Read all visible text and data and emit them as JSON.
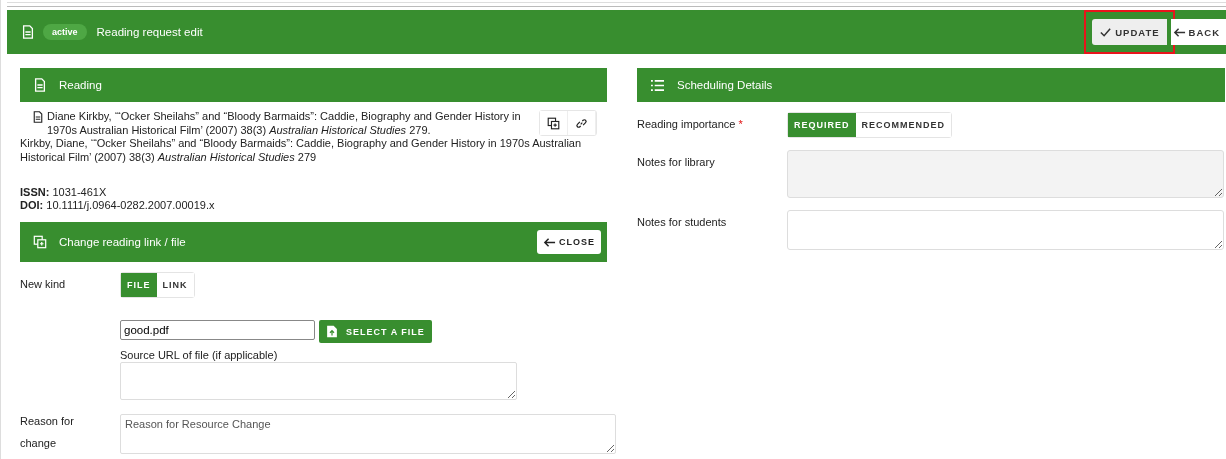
{
  "header": {
    "status": "active",
    "title": "Reading request edit",
    "buttons": [
      {
        "label": "UPDATE",
        "highlighted": true
      },
      {
        "label": "BACK",
        "highlighted": false
      }
    ]
  },
  "reading": {
    "title": "Reading",
    "citations": [
      "Diane Kirkby, ‘“Ocker Sheilahs” and “Bloody Barmaids”: Caddie, Biography and Gender History in 1970s Australian Historical Film’ (2007) 38(3) *Australian Historical Studies* 279.",
      "Kirkby, Diane, ‘“Ocker Sheilahs” and “Bloody Barmaids”: Caddie, Biography and Gender History in 1970s Australian Historical Film’ (2007) 38(3) *Australian Historical Studies* 279"
    ],
    "identifiers": [
      {
        "label": "ISSN:",
        "value": "1031-461X"
      },
      {
        "label": "DOI:",
        "value": "10.1111/j.0964-0282.2007.00019.x"
      }
    ]
  },
  "change": {
    "title": "Change reading link / file",
    "close": "CLOSE",
    "kind_label": "New kind",
    "kinds": [
      {
        "label": "FILE",
        "selected": true
      },
      {
        "label": "LINK",
        "selected": false
      }
    ],
    "file_value": "good.pdf",
    "select_file": "SELECT A FILE",
    "source_label": "Source URL of file (if applicable)",
    "reason_label": "Reason for change",
    "reason_placeholder": "Reason for Resource Change"
  },
  "scheduling": {
    "title": "Scheduling Details",
    "importance_label": "Reading importance",
    "required_mark": "*",
    "importance": [
      {
        "label": "REQUIRED",
        "selected": true
      },
      {
        "label": "RECOMMENDED",
        "selected": false
      }
    ],
    "fields": [
      {
        "label": "Notes for library",
        "disabled": true
      },
      {
        "label": "Notes for students",
        "disabled": false
      }
    ]
  }
}
